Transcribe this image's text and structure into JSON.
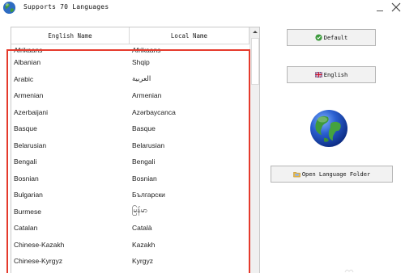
{
  "window": {
    "title": "Supports 70 Languages",
    "minimize_glyph": "_",
    "close_glyph": "✕"
  },
  "language_list": {
    "headers": {
      "english_name": "English Name",
      "local_name": "Local Name"
    },
    "rows": [
      {
        "english": "Afrikaans",
        "local": "Afrikaans"
      },
      {
        "english": "Albanian",
        "local": "Shqip"
      },
      {
        "english": "Arabic",
        "local": "العربية"
      },
      {
        "english": "Armenian",
        "local": "Armenian"
      },
      {
        "english": "Azerbaijani",
        "local": "Azərbaycanca"
      },
      {
        "english": "Basque",
        "local": "Basque"
      },
      {
        "english": "Belarusian",
        "local": "Belarusian"
      },
      {
        "english": "Bengali",
        "local": "Bengali"
      },
      {
        "english": "Bosnian",
        "local": "Bosnian"
      },
      {
        "english": "Bulgarian",
        "local": "Български"
      },
      {
        "english": "Burmese",
        "local": "မြန်မာ"
      },
      {
        "english": "Catalan",
        "local": "Català"
      },
      {
        "english": "Chinese-Kazakh",
        "local": "Kazakh"
      },
      {
        "english": "Chinese-Kyrgyz",
        "local": "Kyrgyz"
      }
    ]
  },
  "buttons": {
    "default_label": "Default",
    "english_label": "English",
    "open_folder_label": "Open Language Folder"
  },
  "colors": {
    "highlight_border": "#e53a2c",
    "default_icon_green": "#3c9a3c",
    "folder_icon_yellow": "#e8b84a"
  },
  "icons": {
    "app": "globe-icon",
    "default": "check-circle-icon",
    "english": "uk-flag-icon",
    "folder": "folder-icon",
    "large": "globe-icon"
  }
}
